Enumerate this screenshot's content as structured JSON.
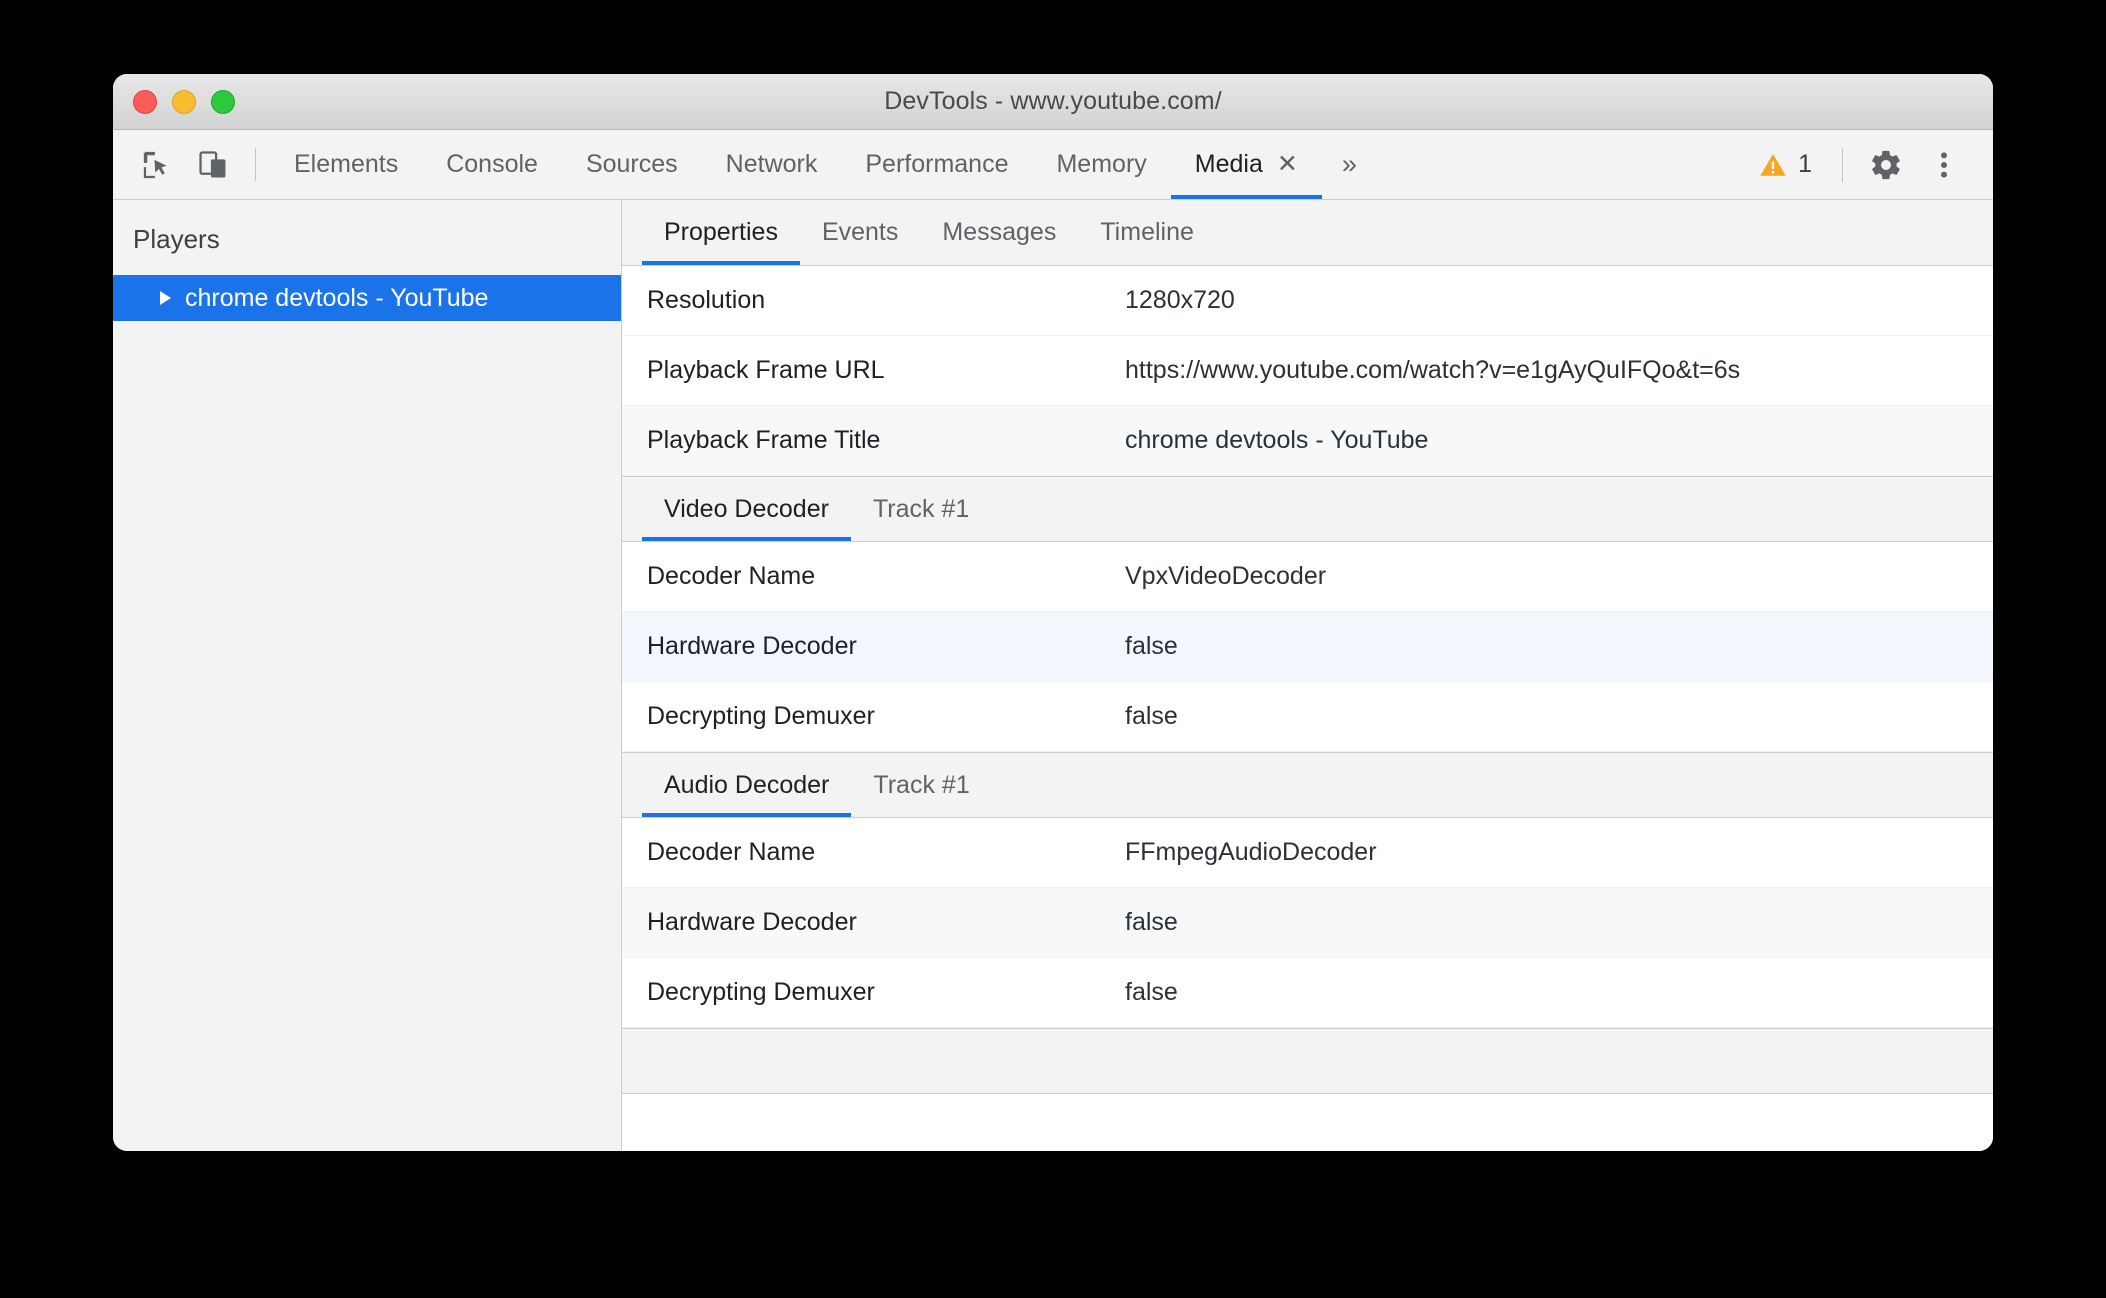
{
  "window": {
    "title": "DevTools - www.youtube.com/",
    "traffic_lights": [
      "close-red",
      "minimize-yellow",
      "zoom-green"
    ]
  },
  "toolbar": {
    "icons": [
      {
        "name": "inspect-element-icon",
        "label": "Inspect element"
      },
      {
        "name": "device-toolbar-icon",
        "label": "Toggle device toolbar"
      }
    ],
    "panels": [
      {
        "label": "Elements",
        "active": false
      },
      {
        "label": "Console",
        "active": false
      },
      {
        "label": "Sources",
        "active": false
      },
      {
        "label": "Network",
        "active": false
      },
      {
        "label": "Performance",
        "active": false
      },
      {
        "label": "Memory",
        "active": false
      },
      {
        "label": "Media",
        "active": true
      }
    ],
    "close_tab_glyph": "✕",
    "more_panels_glyph": "»",
    "warning_count": "1",
    "settings_label": "Settings",
    "more_options_label": "Customize and control DevTools"
  },
  "sidebar": {
    "header": "Players",
    "players": [
      {
        "label": "chrome devtools - YouTube",
        "selected": true,
        "expander": "▶"
      }
    ]
  },
  "content": {
    "tabs": [
      {
        "label": "Properties",
        "active": true
      },
      {
        "label": "Events",
        "active": false
      },
      {
        "label": "Messages",
        "active": false
      },
      {
        "label": "Timeline",
        "active": false
      }
    ],
    "general_properties": [
      {
        "key": "Resolution",
        "value": "1280x720"
      },
      {
        "key": "Playback Frame URL",
        "value": "https://www.youtube.com/watch?v=e1gAyQuIFQo&t=6s"
      },
      {
        "key": "Playback Frame Title",
        "value": "chrome devtools - YouTube"
      }
    ],
    "video_decoder": {
      "section_label": "Video Decoder",
      "track_label": "Track #1",
      "rows": [
        {
          "key": "Decoder Name",
          "value": "VpxVideoDecoder"
        },
        {
          "key": "Hardware Decoder",
          "value": "false"
        },
        {
          "key": "Decrypting Demuxer",
          "value": "false"
        }
      ]
    },
    "audio_decoder": {
      "section_label": "Audio Decoder",
      "track_label": "Track #1",
      "rows": [
        {
          "key": "Decoder Name",
          "value": "FFmpegAudioDecoder"
        },
        {
          "key": "Hardware Decoder",
          "value": "false"
        },
        {
          "key": "Decrypting Demuxer",
          "value": "false"
        }
      ]
    }
  },
  "colors": {
    "accent_blue": "#1a73e8",
    "warning_yellow": "#f5a623",
    "toolbar_bg": "#f3f3f3",
    "selection_blue": "#1a73e8",
    "row_alt_bg": "#f7f8f9",
    "row_highlight_bg": "#f2f7fe"
  }
}
